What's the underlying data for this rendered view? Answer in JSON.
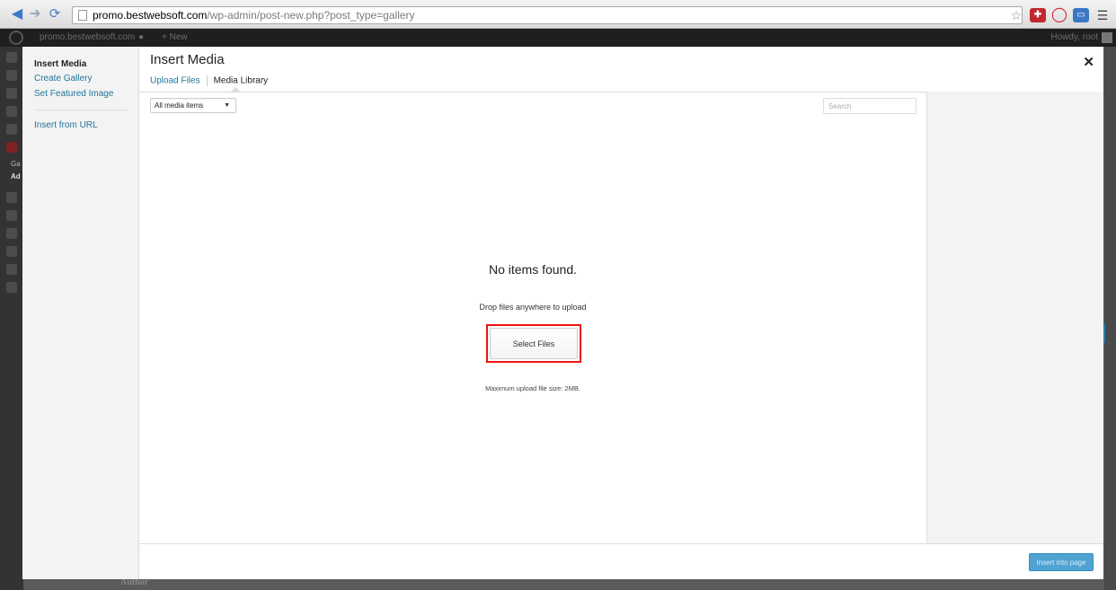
{
  "browser": {
    "url_host": "promo.bestwebsoft.com",
    "url_path": "/wp-admin/post-new.php?post_type=gallery"
  },
  "adminbar": {
    "site_name": "promo.bestwebsoft.com",
    "new_label": "+ New",
    "howdy": "Howdy, root"
  },
  "behind": {
    "author_label": "Author",
    "menu_items": [
      "Ga",
      "Ad"
    ]
  },
  "media_menu": {
    "items": [
      "Insert Media",
      "Create Gallery",
      "Set Featured Image",
      "Insert from URL"
    ]
  },
  "frame": {
    "title": "Insert Media",
    "tabs": [
      "Upload Files",
      "Media Library"
    ],
    "active_tab": "Media Library"
  },
  "toolbar": {
    "filter_selected": "All media items",
    "search_placeholder": "Search"
  },
  "empty_state": {
    "message": "No items found.",
    "drop_text": "Drop files anywhere to upload",
    "button_label": "Select Files",
    "max_size": "Maximum upload file size: 2MB."
  },
  "footer": {
    "insert_label": "Insert into page"
  },
  "colors": {
    "link": "#21759b",
    "primary_button": "#4fa2d1",
    "highlight": "#ee1111"
  }
}
